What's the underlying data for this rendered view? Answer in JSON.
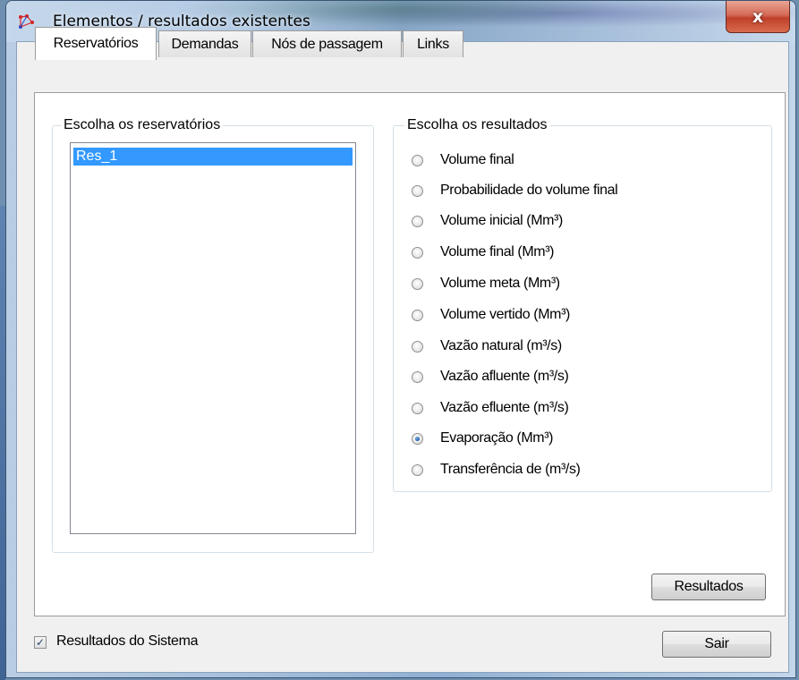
{
  "window": {
    "title": "Elementos / resultados existentes",
    "close_label": "x"
  },
  "tabs": [
    {
      "label": "Reservatórios",
      "active": true
    },
    {
      "label": "Demandas",
      "active": false
    },
    {
      "label": "Nós de passagem",
      "active": false
    },
    {
      "label": "Links",
      "active": false
    }
  ],
  "reservoirs_group": {
    "title": "Escolha os reservatórios",
    "items": [
      {
        "label": "Res_1",
        "selected": true
      }
    ]
  },
  "results_group": {
    "title": "Escolha os resultados",
    "options": [
      {
        "label": "Volume final",
        "checked": false
      },
      {
        "label": "Probabilidade do volume final",
        "checked": false
      },
      {
        "label": "Volume inicial (Mm³)",
        "checked": false
      },
      {
        "label": "Volume final (Mm³)",
        "checked": false
      },
      {
        "label": "Volume meta (Mm³)",
        "checked": false
      },
      {
        "label": "Volume vertido (Mm³)",
        "checked": false
      },
      {
        "label": "Vazão natural (m³/s)",
        "checked": false
      },
      {
        "label": "Vazão afluente (m³/s)",
        "checked": false
      },
      {
        "label": "Vazão efluente (m³/s)",
        "checked": false
      },
      {
        "label": "Evaporação (Mm³)",
        "checked": true
      },
      {
        "label": "Transferência de (m³/s)",
        "checked": false
      }
    ]
  },
  "buttons": {
    "results_label": "Resultados",
    "exit_label": "Sair"
  },
  "system_results": {
    "label": "Resultados do Sistema",
    "checked": true
  },
  "colors": {
    "selection": "#3399ff",
    "close_button": "#c0402a"
  }
}
